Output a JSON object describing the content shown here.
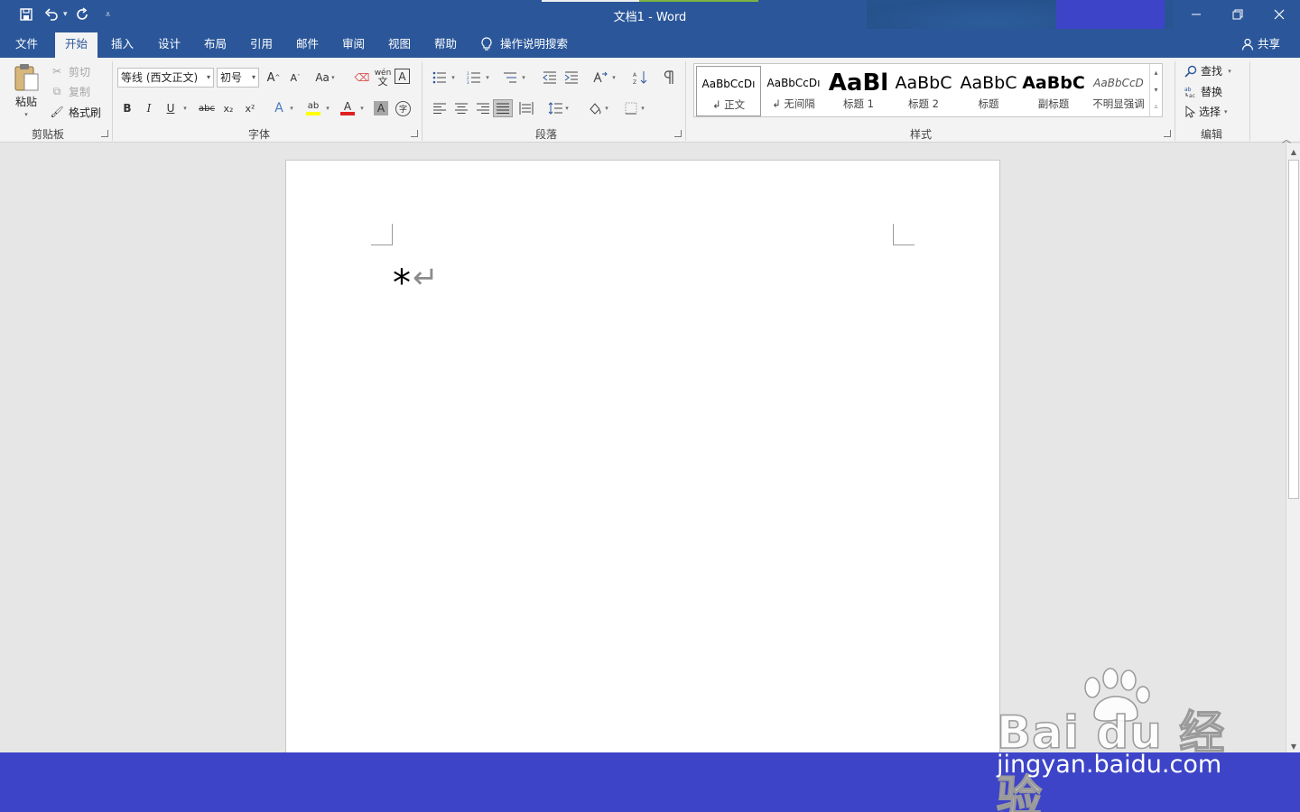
{
  "window": {
    "title": "文档1  -  Word",
    "controls": [
      "minimize",
      "restore",
      "close"
    ]
  },
  "tabs": [
    {
      "label": "文件",
      "active": false
    },
    {
      "label": "开始",
      "active": true
    },
    {
      "label": "插入",
      "active": false
    },
    {
      "label": "设计",
      "active": false
    },
    {
      "label": "布局",
      "active": false
    },
    {
      "label": "引用",
      "active": false
    },
    {
      "label": "邮件",
      "active": false
    },
    {
      "label": "审阅",
      "active": false
    },
    {
      "label": "视图",
      "active": false
    },
    {
      "label": "帮助",
      "active": false
    }
  ],
  "tell_me": "操作说明搜索",
  "share": "共享",
  "clipboard": {
    "paste": "粘贴",
    "cut": "剪切",
    "copy": "复制",
    "format_painter": "格式刷",
    "group": "剪贴板"
  },
  "font": {
    "font_name": "等线 (西文正文)",
    "font_size": "初号",
    "change_case": "Aa",
    "group": "字体",
    "bold": "B",
    "italic": "I",
    "underline": "U",
    "strikethrough": "abc",
    "subscript": "x₂",
    "superscript": "x²",
    "char_border": "A",
    "char_shading": "A",
    "enclose": "字",
    "phonetic": "wén",
    "text_effects": "A",
    "font_color": "A",
    "grow": "A",
    "shrink": "A",
    "accent_highlight": "#ffff00",
    "accent_font_color": "#e02020"
  },
  "paragraph": {
    "group": "段落"
  },
  "styles": {
    "group": "样式",
    "items": [
      {
        "sample": "AaBbCcDı",
        "name": "↲ 正文",
        "active": true
      },
      {
        "sample": "AaBbCcDı",
        "name": "↲ 无间隔",
        "active": false
      },
      {
        "sample": "AaBl",
        "name": "标题 1",
        "active": false
      },
      {
        "sample": "AaBbC",
        "name": "标题 2",
        "active": false
      },
      {
        "sample": "AaBbC",
        "name": "标题",
        "active": false
      },
      {
        "sample": "AaBbC",
        "name": "副标题",
        "active": false
      },
      {
        "sample": "AaBbCcD",
        "name": "不明显强调",
        "active": false
      }
    ]
  },
  "editing": {
    "group": "编辑",
    "find": "查找",
    "replace": "替换",
    "select": "选择"
  },
  "document": {
    "text": "*",
    "paragraph_mark": "↵"
  },
  "watermark": {
    "logo_text": "Bai du 经验",
    "url": "jingyan.baidu.com"
  },
  "colors": {
    "title_bar": "#2b579a",
    "ribbon": "#f3f3f3",
    "overlay": "#3d44c8"
  }
}
